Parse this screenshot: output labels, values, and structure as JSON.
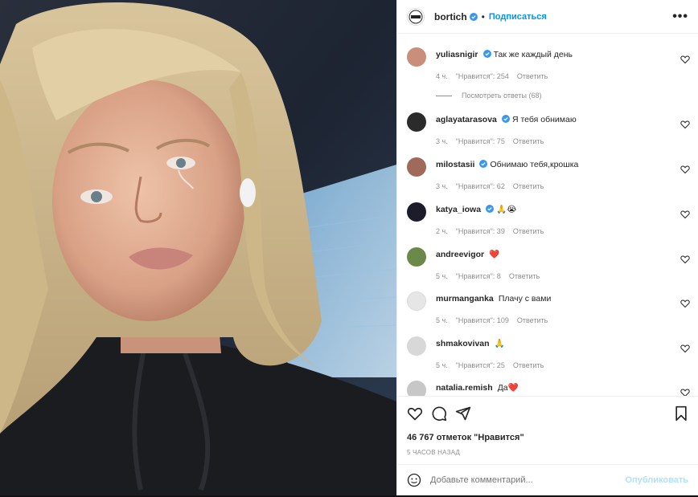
{
  "post": {
    "username": "bortich",
    "separator": "•",
    "follow_label": "Подписаться",
    "more_label": "•••",
    "photo_alt": "selfie"
  },
  "comments": [
    {
      "user": "yuliasnigir",
      "verified": true,
      "text": "Так же каждый день",
      "time": "4 ч.",
      "likes": "\"Нравится\": 254",
      "reply": "Ответить",
      "view_replies": "Посмотреть ответы (68)",
      "avatar_color": "#c98f7a"
    },
    {
      "user": "aglayatarasova",
      "verified": true,
      "text": "Я тебя обнимаю",
      "time": "3 ч.",
      "likes": "\"Нравится\": 75",
      "reply": "Ответить",
      "avatar_color": "#2b2b2b"
    },
    {
      "user": "milostasii",
      "verified": true,
      "text": "Обнимаю тебя,крошка",
      "time": "3 ч.",
      "likes": "\"Нравится\": 62",
      "reply": "Ответить",
      "avatar_color": "#a06a5a"
    },
    {
      "user": "katya_iowa",
      "verified": true,
      "text": "🙏😭",
      "time": "2 ч.",
      "likes": "\"Нравится\": 39",
      "reply": "Ответить",
      "avatar_color": "#1c1c2a"
    },
    {
      "user": "andreevigor",
      "verified": false,
      "text": "❤️",
      "time": "5 ч.",
      "likes": "\"Нравится\": 8",
      "reply": "Ответить",
      "avatar_color": "#6b8a4a"
    },
    {
      "user": "murmanganka",
      "verified": false,
      "text": "Плачу с вами",
      "time": "5 ч.",
      "likes": "\"Нравится\": 109",
      "reply": "Ответить",
      "avatar_color": "#e6e6e6"
    },
    {
      "user": "shmakovivan",
      "verified": false,
      "text": "🙏",
      "time": "5 ч.",
      "likes": "\"Нравится\": 25",
      "reply": "Ответить",
      "avatar_color": "#d8d8d8"
    },
    {
      "user": "natalia.remish",
      "verified": false,
      "text": "Да❤️",
      "time": "",
      "likes": "",
      "reply": "",
      "avatar_color": "#c7c7c7"
    }
  ],
  "footer": {
    "likes_text": "46 767 отметок \"Нравится\"",
    "time_text": "5 ЧАСОВ НАЗАД",
    "comment_placeholder": "Добавьте комментарий...",
    "publish_label": "Опубликовать"
  },
  "colors": {
    "accent": "#0095f6",
    "verified": "#3897f0",
    "publish_disabled": "#b2dffc",
    "heart_red": "#ed4956"
  }
}
